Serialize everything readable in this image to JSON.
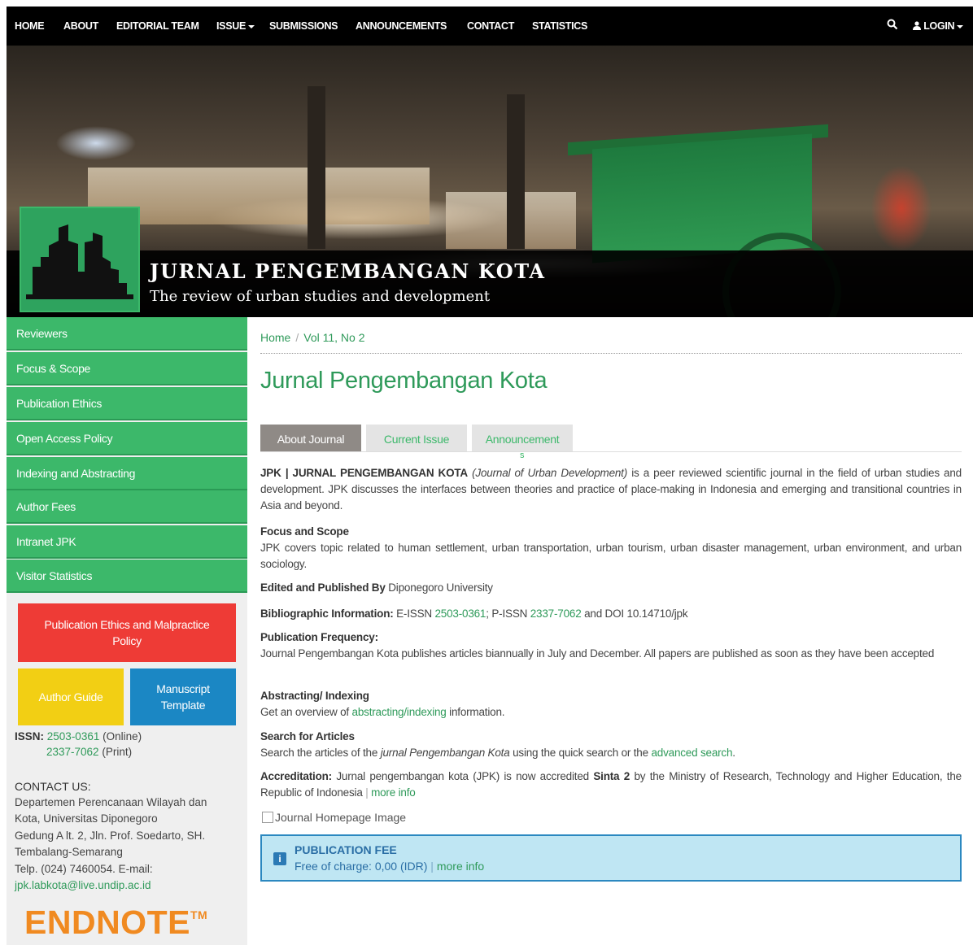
{
  "nav": {
    "items": [
      {
        "label": "HOME",
        "dropdown": false
      },
      {
        "label": "ABOUT",
        "dropdown": false
      },
      {
        "label": "EDITORIAL TEAM",
        "dropdown": false
      },
      {
        "label": "ISSUE",
        "dropdown": true
      },
      {
        "label": "SUBMISSIONS",
        "dropdown": false
      },
      {
        "label": "ANNOUNCEMENTS",
        "dropdown": false
      },
      {
        "label": "CONTACT",
        "dropdown": false
      },
      {
        "label": "STATISTICS",
        "dropdown": false
      }
    ],
    "search_icon": "search-icon",
    "login_label": "LOGIN",
    "login_icon": "user-icon"
  },
  "header": {
    "title": "JURNAL PENGEMBANGAN KOTA",
    "subtitle": "The review of urban studies and development"
  },
  "sidebar": {
    "menu": [
      "Reviewers",
      "Focus & Scope",
      "Publication Ethics",
      "Open Access Policy",
      "Indexing and Abstracting",
      "Author Fees",
      "Intranet JPK",
      "Visitor Statistics"
    ],
    "tiles": {
      "ethics": "Publication Ethics and Malpractice Policy",
      "author_guide": "Author Guide",
      "template": "Manuscript Template"
    },
    "issn": {
      "label": "ISSN:",
      "online": "2503-0361",
      "online_suffix": "(Online)",
      "print": "2337-7062",
      "print_suffix": "(Print)"
    },
    "contact": {
      "heading": "CONTACT US:",
      "lines": [
        "Departemen Perencanaan Wilayah dan",
        "Kota, Universitas Diponegoro",
        "Gedung A lt. 2, Jln. Prof. Soedarto, SH.",
        "Tembalang-Semarang",
        "Telp. (024) 7460054. E-mail:"
      ],
      "email": "jpk.labkota@live.undip.ac.id"
    },
    "endnote": "ENDNOTE",
    "endnote_tm": "TM"
  },
  "breadcrumb": {
    "home": "Home",
    "separator": "/",
    "current": "Vol 11, No 2"
  },
  "page_title": "Jurnal Pengembangan Kota",
  "tabs": [
    {
      "label": "About Journal",
      "active": true
    },
    {
      "label": "Current Issue",
      "active": false
    },
    {
      "label": "Announcement",
      "active": false
    }
  ],
  "tab_stray_char": "s",
  "content": {
    "intro": {
      "name": "JPK | JURNAL PENGEMBANGAN KOTA",
      "italic": "(Journal of Urban Development)",
      "rest": "is a peer reviewed scientific journal in the field of urban studies and development. JPK discusses the interfaces between theories and practice of place-making in Indonesia and emerging and transitional countries in Asia and beyond."
    },
    "focus": {
      "heading": "Focus and Scope",
      "text": "JPK covers topic related to human settlement, urban transportation, urban tourism, urban disaster management, urban environment, and urban sociology."
    },
    "published": {
      "label": "Edited and Published By",
      "value": "Diponegoro University"
    },
    "biblio": {
      "label": "Bibliographic Information:",
      "eissn_label": "E-ISSN",
      "eissn": "2503-0361",
      "sep": ";",
      "pissn_label": "P-ISSN",
      "pissn": "2337-7062",
      "doi": "and DOI 10.14710/jpk"
    },
    "frequency": {
      "heading": "Publication Frequency:",
      "text": "Journal Pengembangan Kota publishes articles biannually in July and December. All papers are published as soon as they have been accepted"
    },
    "abstracting": {
      "heading": "Abstracting/ Indexing",
      "pre": "Get an overview of",
      "link": "abstracting/indexing",
      "post": "information."
    },
    "search": {
      "heading": "Search for Articles",
      "pre": "Search the articles of the",
      "italic": "jurnal Pengembangan Kota",
      "mid": "using the quick search or the",
      "link": "advanced search",
      "post": "."
    },
    "accreditation": {
      "label": "Accreditation:",
      "pre": "Jurnal pengembangan kota (JPK) is now accredited",
      "bold": "Sinta 2",
      "post": "by the Ministry of Research, Technology and Higher Education, the Republic of Indonesia",
      "sep": "|",
      "link": "more info"
    },
    "image_alt": "Journal Homepage Image"
  },
  "fee": {
    "icon": "info-icon",
    "title": "PUBLICATION FEE",
    "text": "Free of charge: 0,00 (IDR)",
    "sep": "|",
    "link": "more info"
  },
  "colors": {
    "accent_green": "#3cb86a",
    "link_green": "#2f9a5a",
    "ethics_red": "#ee3b36",
    "guide_yellow": "#f2cf14",
    "template_blue": "#1b87c4",
    "fee_bg": "#bfe6f3",
    "endnote_orange": "#f08a21"
  }
}
